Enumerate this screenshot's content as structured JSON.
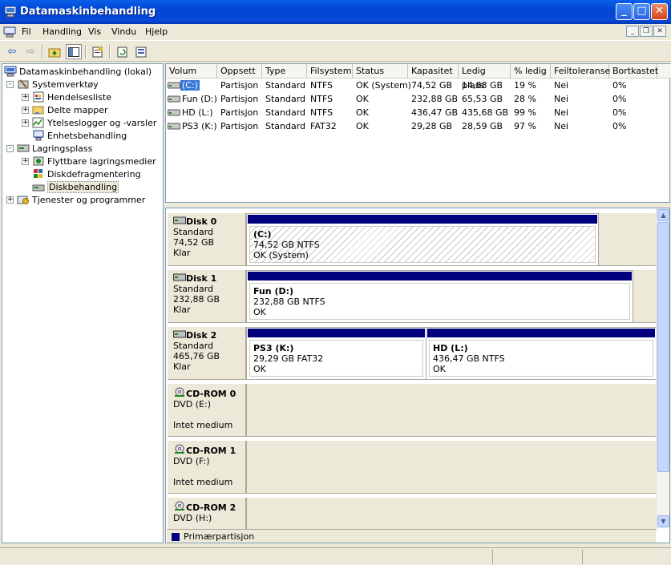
{
  "window": {
    "title": "Datamaskinbehandling",
    "minimize": "_",
    "maximize": "□",
    "close": "✕"
  },
  "menu": [
    "Fil",
    "Handling",
    "Vis",
    "Vindu",
    "Hjelp"
  ],
  "tree": {
    "root": "Datamaskinbehandling (lokal)",
    "items": [
      {
        "label": "Systemverktøy",
        "level": 1,
        "expander": "-"
      },
      {
        "label": "Hendelsesliste",
        "level": 2,
        "expander": "+"
      },
      {
        "label": "Delte mapper",
        "level": 2,
        "expander": "+"
      },
      {
        "label": "Ytelseslogger og -varsler",
        "level": 2,
        "expander": "+"
      },
      {
        "label": "Enhetsbehandling",
        "level": 2,
        "expander": ""
      },
      {
        "label": "Lagringsplass",
        "level": 1,
        "expander": "-"
      },
      {
        "label": "Flyttbare lagringsmedier",
        "level": 2,
        "expander": "+"
      },
      {
        "label": "Diskdefragmentering",
        "level": 2,
        "expander": ""
      },
      {
        "label": "Diskbehandling",
        "level": 2,
        "expander": ""
      },
      {
        "label": "Tjenester og programmer",
        "level": 1,
        "expander": "+"
      }
    ]
  },
  "volumes": {
    "columns": [
      "Volum",
      "Oppsett",
      "Type",
      "Filsystem",
      "Status",
      "Kapasitet",
      "Ledig plass",
      "% ledig",
      "Feiltoleranse",
      "Bortkastet"
    ],
    "rows": [
      [
        "(C:)",
        "Partisjon",
        "Standard",
        "NTFS",
        "OK (System)",
        "74,52 GB",
        "14,88 GB",
        "19 %",
        "Nei",
        "0%"
      ],
      [
        "Fun (D:)",
        "Partisjon",
        "Standard",
        "NTFS",
        "OK",
        "232,88 GB",
        "65,53 GB",
        "28 %",
        "Nei",
        "0%"
      ],
      [
        "HD (L:)",
        "Partisjon",
        "Standard",
        "NTFS",
        "OK",
        "436,47 GB",
        "435,68 GB",
        "99 %",
        "Nei",
        "0%"
      ],
      [
        "PS3 (K:)",
        "Partisjon",
        "Standard",
        "FAT32",
        "OK",
        "29,28 GB",
        "28,59 GB",
        "97 %",
        "Nei",
        "0%"
      ]
    ]
  },
  "disks": [
    {
      "name": "Disk 0",
      "type": "Standard",
      "size": "74,52 GB",
      "state": "Klar",
      "partitions": [
        {
          "name": "(C:)",
          "size": "74,52 GB NTFS",
          "status": "OK (System)"
        }
      ]
    },
    {
      "name": "Disk 1",
      "type": "Standard",
      "size": "232,88 GB",
      "state": "Klar",
      "partitions": [
        {
          "name": "Fun  (D:)",
          "size": "232,88 GB NTFS",
          "status": "OK"
        }
      ]
    },
    {
      "name": "Disk 2",
      "type": "Standard",
      "size": "465,76 GB",
      "state": "Klar",
      "partitions": [
        {
          "name": "PS3  (K:)",
          "size": "29,29 GB FAT32",
          "status": "OK"
        },
        {
          "name": "HD  (L:)",
          "size": "436,47 GB NTFS",
          "status": "OK"
        }
      ]
    },
    {
      "name": "CD-ROM 0",
      "type": "DVD (E:)",
      "state": "Intet medium"
    },
    {
      "name": "CD-ROM 1",
      "type": "DVD (F:)",
      "state": "Intet medium"
    },
    {
      "name": "CD-ROM 2",
      "type": "DVD (H:)",
      "state": ""
    }
  ],
  "legend": {
    "label": "Primærpartisjon",
    "color": "#00007f"
  },
  "scroll": {
    "up": "▲",
    "down": "▼"
  }
}
